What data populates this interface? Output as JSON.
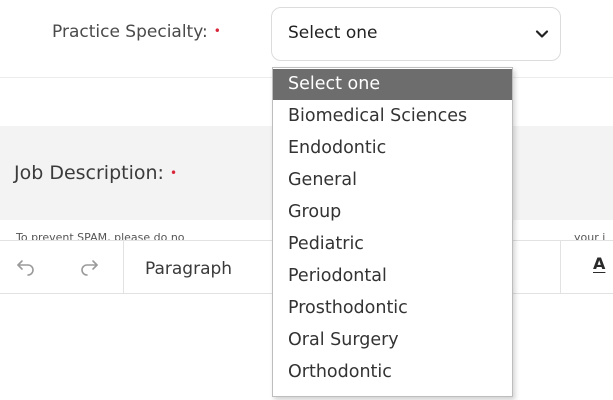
{
  "form": {
    "practice_specialty_label": "Practice Specialty:",
    "required_marker": "•",
    "practice_specialty_value": "Select one",
    "job_description_label": "Job Description:",
    "spam_notice_left": "To prevent SPAM, please do no",
    "spam_notice_right": "your j"
  },
  "dropdown": {
    "options": [
      "Select one",
      "Biomedical Sciences",
      "Endodontic",
      "General",
      "Group",
      "Pediatric",
      "Periodontal",
      "Prosthodontic",
      "Oral Surgery",
      "Orthodontic"
    ],
    "selected_index": 0
  },
  "toolbar": {
    "block_format": "Paragraph",
    "font_color_glyph": "A",
    "icons": [
      "undo-icon",
      "redo-icon"
    ]
  },
  "colors": {
    "required": "#d9263b",
    "selected_option_bg": "#6d6d6d",
    "panel_bg": "#f3f3f3"
  }
}
